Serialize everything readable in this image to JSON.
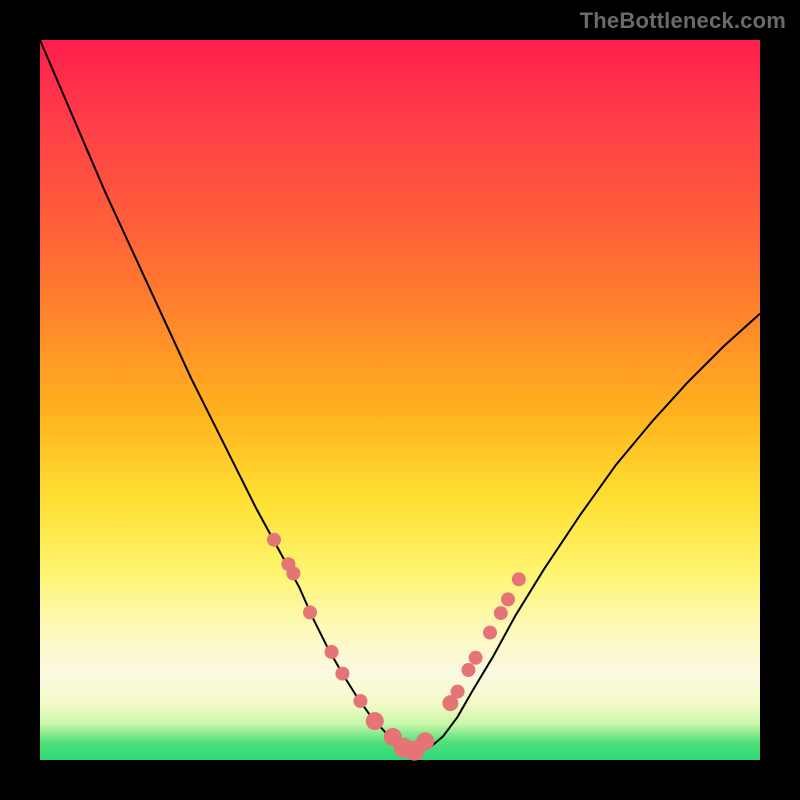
{
  "watermark": "TheBottleneck.com",
  "colors": {
    "page_bg": "#000000",
    "curve": "#000000",
    "marker": "#e57477",
    "gradient_stops": [
      "#ff1e4c",
      "#ff3a4a",
      "#ff6038",
      "#ff8a2a",
      "#ffb31e",
      "#ffe033",
      "#fff571",
      "#fdf9bc",
      "#faf9e1",
      "#f5fbc9",
      "#c8f7a8",
      "#53e07c",
      "#2bd977"
    ]
  },
  "chart_data": {
    "type": "line",
    "title": "",
    "xlabel": "",
    "ylabel": "",
    "xlim": [
      0,
      100
    ],
    "ylim": [
      0,
      100
    ],
    "grid": false,
    "x": [
      0,
      3,
      6,
      9,
      12,
      15,
      18,
      21,
      24,
      27,
      30,
      33,
      36,
      38,
      40,
      42,
      44,
      46,
      48,
      50,
      52,
      54,
      56,
      58,
      60,
      63,
      66,
      70,
      75,
      80,
      85,
      90,
      95,
      100
    ],
    "values": [
      100,
      93,
      86,
      79,
      72.5,
      66,
      59.5,
      53,
      47,
      41,
      35,
      29.5,
      24,
      19.5,
      15.5,
      12,
      8.8,
      6,
      3.8,
      2,
      1.2,
      1.6,
      3.3,
      6,
      9.5,
      14.5,
      20,
      26.5,
      34,
      41,
      47,
      52.5,
      57.5,
      62
    ],
    "markers": {
      "x": [
        32.5,
        34.5,
        35.2,
        37.5,
        40.5,
        42.0,
        44.5,
        46.5,
        49.0,
        50.5,
        52.0,
        53.5,
        57.0,
        58.0,
        59.5,
        60.5,
        62.5,
        64.0,
        65.0,
        66.5
      ],
      "y": [
        30.6,
        27.2,
        25.9,
        20.5,
        15.0,
        12.0,
        8.2,
        5.4,
        3.2,
        1.7,
        1.3,
        2.6,
        7.9,
        9.5,
        12.5,
        14.2,
        17.7,
        20.4,
        22.3,
        25.1
      ],
      "r": [
        7,
        7,
        7,
        7,
        7,
        7,
        7,
        9,
        9,
        10,
        10,
        9,
        8,
        7,
        7,
        7,
        7,
        7,
        7,
        7
      ]
    },
    "legend": []
  }
}
